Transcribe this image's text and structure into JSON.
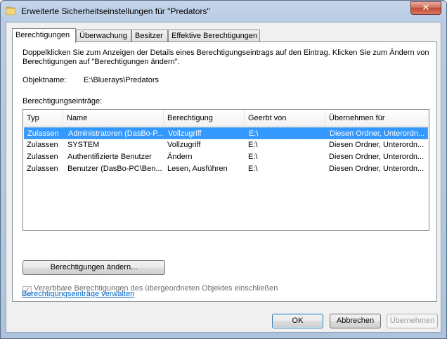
{
  "window": {
    "title": "Erweiterte Sicherheitseinstellungen für \"Predators\"",
    "close_glyph": "✕"
  },
  "tabs": [
    {
      "label": "Berechtigungen",
      "active": true
    },
    {
      "label": "Überwachung",
      "active": false
    },
    {
      "label": "Besitzer",
      "active": false
    },
    {
      "label": "Effektive Berechtigungen",
      "active": false
    }
  ],
  "panel": {
    "description": "Doppelklicken Sie zum Anzeigen der Details eines Berechtigungseintrags auf den Eintrag. Klicken Sie zum Ändern von Berechtigungen auf \"Berechtigungen ändern\".",
    "object_label": "Objektname:",
    "object_value": "E:\\Bluerays\\Predators",
    "entries_label": "Berechtigungseinträge:",
    "columns": [
      "Typ",
      "Name",
      "Berechtigung",
      "Geerbt von",
      "Übernehmen für"
    ],
    "rows": [
      {
        "typ": "Zulassen",
        "name": "Administratoren (DasBo-P...",
        "berechtigung": "Vollzugriff",
        "geerbt": "E:\\",
        "uebernehmen": "Diesen Ordner, Unterordn...",
        "selected": true
      },
      {
        "typ": "Zulassen",
        "name": "SYSTEM",
        "berechtigung": "Vollzugriff",
        "geerbt": "E:\\",
        "uebernehmen": "Diesen Ordner, Unterordn...",
        "selected": false
      },
      {
        "typ": "Zulassen",
        "name": "Authentifizierte Benutzer",
        "berechtigung": "Ändern",
        "geerbt": "E:\\",
        "uebernehmen": "Diesen Ordner, Unterordn...",
        "selected": false
      },
      {
        "typ": "Zulassen",
        "name": "Benutzer (DasBo-PC\\Ben...",
        "berechtigung": "Lesen, Ausführen",
        "geerbt": "E:\\",
        "uebernehmen": "Diesen Ordner, Unterordn...",
        "selected": false
      }
    ],
    "change_button": "Berechtigungen ändern...",
    "inherit_checkbox": {
      "label": "Vererbbare Berechtigungen des übergeordneten Objektes einschließen",
      "checked": true,
      "glyph": "✓"
    },
    "manage_link": "Berechtigungseinträge verwalten"
  },
  "footer": {
    "ok": "OK",
    "cancel": "Abbrechen",
    "apply": "Übernehmen"
  }
}
